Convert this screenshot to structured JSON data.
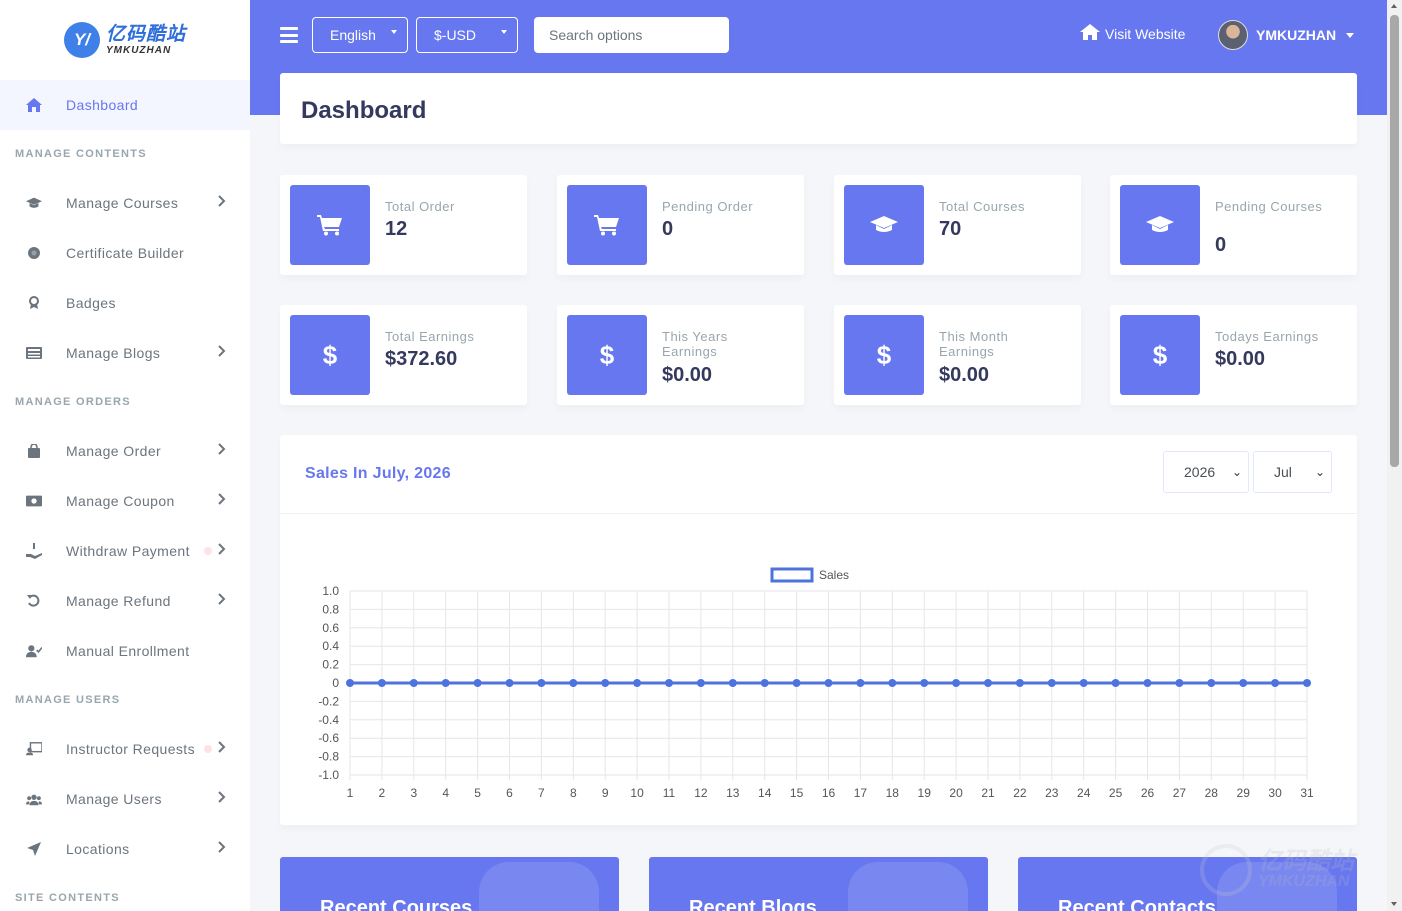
{
  "brand": {
    "name_cn": "亿码酷站",
    "name_en": "YMKUZHAN",
    "mark": "Y"
  },
  "sidebar": {
    "dashboard": "Dashboard",
    "sections": [
      {
        "header": "MANAGE CONTENTS",
        "items": [
          {
            "label": "Manage Courses",
            "icon": "graduation-cap-icon",
            "chevron": true
          },
          {
            "label": "Certificate Builder",
            "icon": "certificate-icon",
            "chevron": false
          },
          {
            "label": "Badges",
            "icon": "award-icon",
            "chevron": false
          },
          {
            "label": "Manage Blogs",
            "icon": "newspaper-icon",
            "chevron": true
          }
        ]
      },
      {
        "header": "MANAGE ORDERS",
        "items": [
          {
            "label": "Manage Order",
            "icon": "shopping-bag-icon",
            "chevron": true
          },
          {
            "label": "Manage Coupon",
            "icon": "money-bill-icon",
            "chevron": true
          },
          {
            "label": "Withdraw Payment",
            "icon": "hand-holding-dollar-icon",
            "chevron": true,
            "dot": true
          },
          {
            "label": "Manage Refund",
            "icon": "undo-icon",
            "chevron": true
          },
          {
            "label": "Manual Enrollment",
            "icon": "user-check-icon",
            "chevron": false
          }
        ]
      },
      {
        "header": "MANAGE USERS",
        "items": [
          {
            "label": "Instructor Requests",
            "icon": "chalkboard-teacher-icon",
            "chevron": true,
            "dot": true
          },
          {
            "label": "Manage Users",
            "icon": "users-icon",
            "chevron": true
          },
          {
            "label": "Locations",
            "icon": "location-arrow-icon",
            "chevron": true
          }
        ]
      },
      {
        "header": "SITE CONTENTS",
        "items": []
      }
    ]
  },
  "topbar": {
    "language": "English",
    "currency": "$-USD",
    "search_placeholder": "Search options",
    "visit_website": "Visit Website",
    "username": "YMKUZHAN"
  },
  "page_title": "Dashboard",
  "stats": [
    {
      "label": "Total Order",
      "value": "12",
      "icon": "cart-icon"
    },
    {
      "label": "Pending Order",
      "value": "0",
      "icon": "cart-icon"
    },
    {
      "label": "Total Courses",
      "value": "70",
      "icon": "graduation-cap-icon"
    },
    {
      "label": "Pending Courses",
      "value": "0",
      "icon": "graduation-cap-icon"
    },
    {
      "label": "Total Earnings",
      "value": "$372.60",
      "icon": "dollar-icon"
    },
    {
      "label": "This Years Earnings",
      "value": "$0.00",
      "icon": "dollar-icon"
    },
    {
      "label": "This Month Earnings",
      "value": "$0.00",
      "icon": "dollar-icon"
    },
    {
      "label": "Todays Earnings",
      "value": "$0.00",
      "icon": "dollar-icon"
    }
  ],
  "sales": {
    "title": "Sales In July, 2026",
    "year": "2026",
    "month": "Jul"
  },
  "chart_data": {
    "type": "line",
    "x": [
      1,
      2,
      3,
      4,
      5,
      6,
      7,
      8,
      9,
      10,
      11,
      12,
      13,
      14,
      15,
      16,
      17,
      18,
      19,
      20,
      21,
      22,
      23,
      24,
      25,
      26,
      27,
      28,
      29,
      30,
      31
    ],
    "series": [
      {
        "name": "Sales",
        "values": [
          0,
          0,
          0,
          0,
          0,
          0,
          0,
          0,
          0,
          0,
          0,
          0,
          0,
          0,
          0,
          0,
          0,
          0,
          0,
          0,
          0,
          0,
          0,
          0,
          0,
          0,
          0,
          0,
          0,
          0,
          0
        ]
      }
    ],
    "yticks": [
      "1.0",
      "0.8",
      "0.6",
      "0.4",
      "0.2",
      "0",
      "-0.2",
      "-0.4",
      "-0.6",
      "-0.8",
      "-1.0"
    ],
    "ylim": [
      -1.0,
      1.0
    ],
    "grid": true,
    "legend": "top-center",
    "color": "#4e73df"
  },
  "bottom_cards": [
    "Recent Courses",
    "Recent Blogs",
    "Recent Contacts"
  ],
  "colors": {
    "primary": "#6777ef",
    "line": "#4e73df"
  }
}
